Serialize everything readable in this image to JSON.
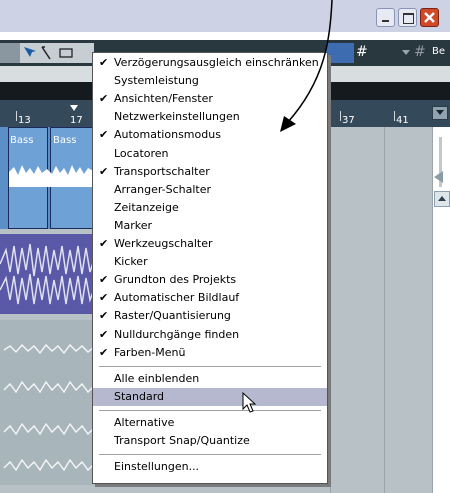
{
  "toolbar": {
    "grid_symbol": "#",
    "grid_symbol2": "#",
    "truncated_text": "Be"
  },
  "ruler": {
    "numbers": [
      "13",
      "17",
      "37",
      "41"
    ]
  },
  "tracks": {
    "clip1": "Bass",
    "clip2": "Bass"
  },
  "menu": {
    "items": [
      {
        "label": "Verzögerungsausgleich einschränken",
        "checked": true
      },
      {
        "label": "Systemleistung",
        "checked": false
      },
      {
        "label": "Ansichten/Fenster",
        "checked": true
      },
      {
        "label": "Netzwerkeinstellungen",
        "checked": false
      },
      {
        "label": "Automationsmodus",
        "checked": true
      },
      {
        "label": "Locatoren",
        "checked": false
      },
      {
        "label": "Transportschalter",
        "checked": true
      },
      {
        "label": "Arranger-Schalter",
        "checked": false
      },
      {
        "label": "Zeitanzeige",
        "checked": false
      },
      {
        "label": "Marker",
        "checked": false
      },
      {
        "label": "Werkzeugschalter",
        "checked": true
      },
      {
        "label": "Kicker",
        "checked": false
      },
      {
        "label": "Grundton des Projekts",
        "checked": true
      },
      {
        "label": "Automatischer Bildlauf",
        "checked": true
      },
      {
        "label": "Raster/Quantisierung",
        "checked": true
      },
      {
        "label": "Nulldurchgänge finden",
        "checked": true
      },
      {
        "label": "Farben-Menü",
        "checked": true
      }
    ],
    "show_all": "Alle einblenden",
    "standard": "Standard",
    "alternative": "Alternative",
    "transport_snap": "Transport  Snap/Quantize",
    "settings": "Einstellungen...",
    "check_glyph": "✔"
  }
}
